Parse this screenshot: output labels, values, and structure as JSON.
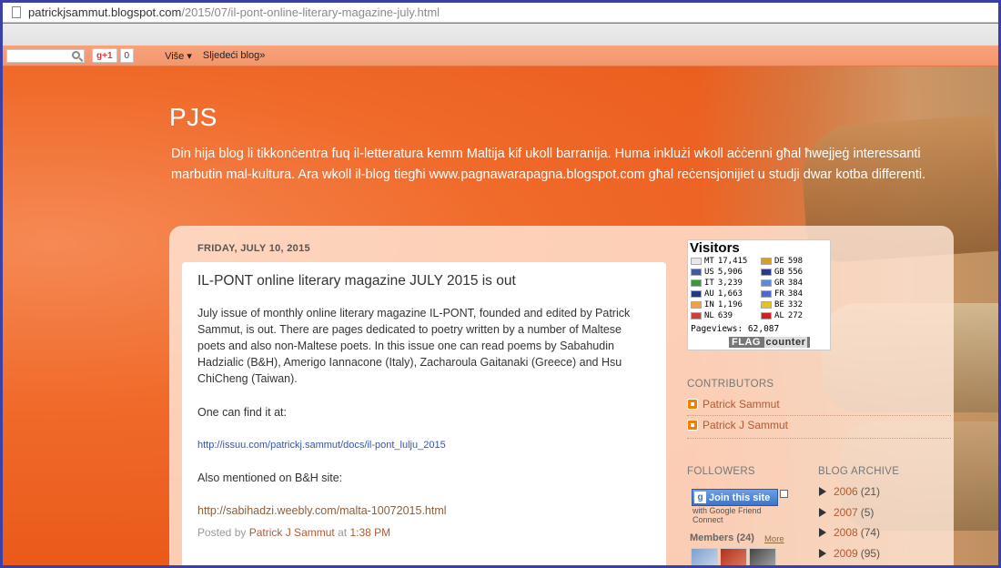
{
  "browser": {
    "url_host": "patrickjsammut.blogspot.com",
    "url_path": "/2015/07/il-pont-online-literary-magazine-july.html"
  },
  "navbar": {
    "gplus_label": "g+1",
    "gplus_count": "0",
    "more_label": "Više ▾",
    "next_blog_label": "Sljedeći blog»"
  },
  "blog": {
    "title": "PJS",
    "description": "Din hija blog li tikkonċentra fuq il-letteratura kemm Maltija kif ukoll barranija. Huma inklużi wkoll aċċenni għal ħwejjeġ interessanti marbutin mal-kultura. Ara wkoll il-blog tiegħi www.pagnawarapagna.blogspot.com għal reċensjonijiet u studji dwar kotba differenti."
  },
  "post": {
    "date": "FRIDAY, JULY 10, 2015",
    "title": "IL-PONT online literary magazine JULY 2015 is out",
    "paragraph1": "July issue of monthly online literary magazine IL-PONT, founded and edited by Patrick Sammut, is out. There are pages dedicated to poetry written by a number of Maltese poets and also non-Maltese poets. In this issue one can read poems by Sabahudin Hadzialic (B&H), Amerigo Iannacone (Italy), Zacharoula Gaitanaki (Greece) and Hsu ChiCheng (Taiwan).",
    "paragraph2": "One can find it at:",
    "link1": "http://issuu.com/patrickj.sammut/docs/il-pont_lulju_2015",
    "paragraph3": "Also mentioned on B&H site:",
    "link2": "http://sabihadzi.weebly.com/malta-10072015.html",
    "footer_prefix": "Posted by",
    "footer_author": "Patrick J Sammut",
    "footer_at": "at",
    "footer_time": "1:38 PM"
  },
  "counter": {
    "title": "Visitors",
    "left": [
      {
        "code": "MT",
        "count": "17,415",
        "color": "#e8e8e8"
      },
      {
        "code": "US",
        "count": "5,906",
        "color": "#3c5aa8"
      },
      {
        "code": "IT",
        "count": "3,239",
        "color": "#3a9a3a"
      },
      {
        "code": "AU",
        "count": "1,663",
        "color": "#1e3a8a"
      },
      {
        "code": "IN",
        "count": "1,196",
        "color": "#f2a040"
      },
      {
        "code": "NL",
        "count": "639",
        "color": "#c84040"
      }
    ],
    "right": [
      {
        "code": "DE",
        "count": "598",
        "color": "#d8a020"
      },
      {
        "code": "GB",
        "count": "556",
        "color": "#2a3a8a"
      },
      {
        "code": "GR",
        "count": "384",
        "color": "#5a8ad8"
      },
      {
        "code": "FR",
        "count": "384",
        "color": "#4a6ad0"
      },
      {
        "code": "BE",
        "count": "332",
        "color": "#e8c020"
      },
      {
        "code": "AL",
        "count": "272",
        "color": "#d02020"
      }
    ],
    "pageviews": "Pageviews: 62,087",
    "badge_flag": "FLAG",
    "badge_counter": "counter"
  },
  "contributors": {
    "heading": "CONTRIBUTORS",
    "items": [
      "Patrick Sammut",
      "Patrick J Sammut"
    ]
  },
  "followers": {
    "heading": "FOLLOWERS",
    "join_label": "Join this site",
    "gfc_text": "with Google Friend Connect",
    "members_label": "Members (24)",
    "more_label": "More"
  },
  "archive": {
    "heading": "BLOG ARCHIVE",
    "items": [
      {
        "year": "2006",
        "count": "(21)"
      },
      {
        "year": "2007",
        "count": "(5)"
      },
      {
        "year": "2008",
        "count": "(74)"
      },
      {
        "year": "2009",
        "count": "(95)"
      }
    ]
  },
  "colors": {
    "accent": "#f05a1a",
    "link": "#b05a30",
    "frame": "#3b3fa8"
  }
}
